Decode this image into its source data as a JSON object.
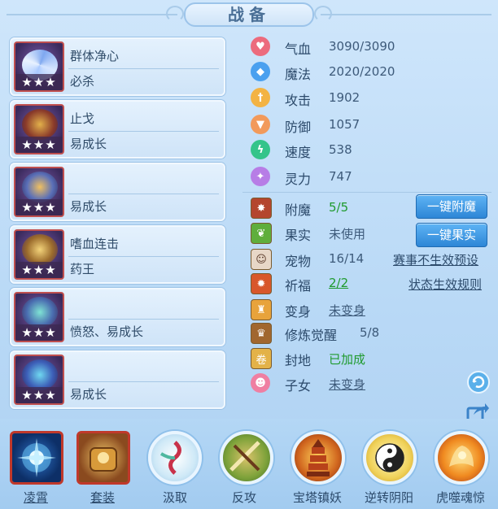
{
  "title": "战备",
  "cards": [
    {
      "line1": "群体净心",
      "line2": "必杀",
      "stars": "★★★",
      "icon": "fan-weapon-icon"
    },
    {
      "line1": "止戈",
      "line2": "易成长",
      "stars": "★★★",
      "icon": "armor-icon"
    },
    {
      "line1": "",
      "line2": "易成长",
      "stars": "★★★",
      "icon": "helmet-icon"
    },
    {
      "line1": "嗜血连击",
      "line2": "药王",
      "stars": "★★★",
      "icon": "necklace-icon"
    },
    {
      "line1": "",
      "line2": "愤怒、易成长",
      "stars": "★★★",
      "icon": "belt-icon"
    },
    {
      "line1": "",
      "line2": "易成长",
      "stars": "★★★",
      "icon": "boots-icon"
    }
  ],
  "stats": [
    {
      "label": "气血",
      "value": "3090/3090",
      "icon": "heart-icon",
      "color": "#ec6b7d"
    },
    {
      "label": "魔法",
      "value": "2020/2020",
      "icon": "mana-icon",
      "color": "#4aa0ef"
    },
    {
      "label": "攻击",
      "value": "1902",
      "icon": "sword-icon",
      "color": "#f3b343"
    },
    {
      "label": "防御",
      "value": "1057",
      "icon": "shield-icon",
      "color": "#f29a5b"
    },
    {
      "label": "速度",
      "value": "538",
      "icon": "lightning-icon",
      "color": "#34c48a"
    },
    {
      "label": "灵力",
      "value": "747",
      "icon": "spirit-icon",
      "color": "#b77de6"
    }
  ],
  "status": {
    "fumo": {
      "label": "附魔",
      "value": "5/5"
    },
    "guoshi": {
      "label": "果实",
      "value": "未使用"
    },
    "pet": {
      "label": "宠物",
      "value": "16/14"
    },
    "qifu": {
      "label": "祈福",
      "value": "2/2"
    },
    "bianshen": {
      "label": "变身",
      "value": "未变身"
    },
    "xiulian": {
      "label": "修炼觉醒",
      "value": "5/8"
    },
    "fengdi": {
      "label": "封地",
      "value": "已加成"
    },
    "zinv": {
      "label": "子女",
      "value": "未变身"
    }
  },
  "buttons": {
    "fumo": "一键附魔",
    "guoshi": "一键果实"
  },
  "links": {
    "preset": "赛事不生效预设",
    "rules": "状态生效规则"
  },
  "skills": [
    {
      "label": "凌霄",
      "icon": "lingxiao-icon"
    },
    {
      "label": "套装",
      "icon": "suit-icon"
    },
    {
      "label": "汲取",
      "icon": "absorb-icon"
    },
    {
      "label": "反攻",
      "icon": "counter-icon"
    },
    {
      "label": "宝塔镇妖",
      "icon": "pagoda-icon"
    },
    {
      "label": "逆转阴阳",
      "icon": "yinyang-icon"
    },
    {
      "label": "虎噬魂惊",
      "icon": "tiger-icon"
    }
  ]
}
